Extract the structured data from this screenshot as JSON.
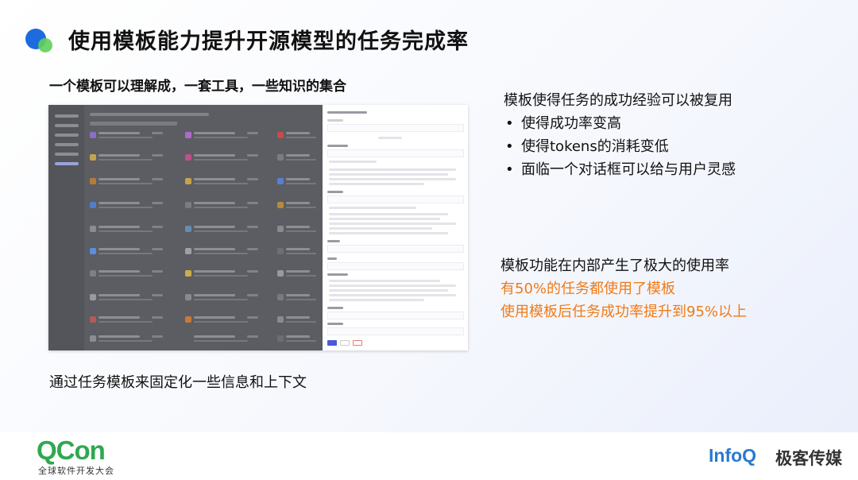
{
  "slide": {
    "title": "使用模板能力提升开源模型的任务完成率",
    "subtitle": "一个模板可以理解成，一套工具，一些知识的集合",
    "caption": "通过任务模板来固定化一些信息和上下文"
  },
  "benefits": {
    "heading": "模板使得任务的成功经验可以被复用",
    "items": [
      "使得成功率变高",
      "使得tokens的消耗变低",
      "面临一个对话框可以给与用户灵感"
    ]
  },
  "stats": {
    "line1": "模板功能在内部产生了极大的使用率",
    "line2": "有50%的任务都使用了模板",
    "line3": "使用模板后任务成功率提升到95%以上"
  },
  "footer": {
    "qcon_logo": "QCon",
    "qcon_sub": "全球软件开发大会",
    "infoq_logo": "InfoQ",
    "infoq_cn": "极客传媒"
  },
  "colors": {
    "accent_orange": "#f07a16",
    "brand_blue": "#1e6be0",
    "brand_green": "#2fa84f"
  }
}
